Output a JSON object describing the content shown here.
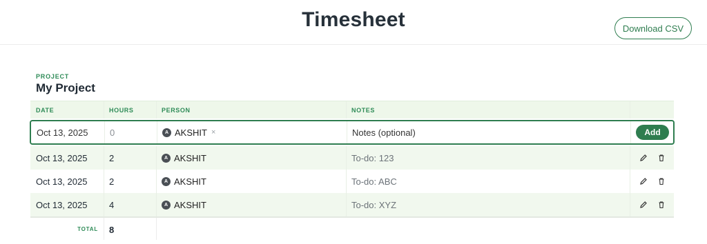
{
  "header": {
    "title": "Timesheet",
    "download_label": "Download CSV"
  },
  "project": {
    "label": "PROJECT",
    "name": "My Project"
  },
  "table": {
    "columns": [
      "DATE",
      "HOURS",
      "PERSON",
      "NOTES"
    ],
    "edit_row": {
      "date": "Oct 13, 2025",
      "hours": "0",
      "person_initial": "A",
      "person": "AKSHIT",
      "remove_glyph": "×",
      "notes_placeholder": "Notes (optional)",
      "add_label": "Add"
    },
    "rows": [
      {
        "date": "Oct 13, 2025",
        "hours": "2",
        "person_initial": "A",
        "person": "AKSHIT",
        "notes": "To-do: 123"
      },
      {
        "date": "Oct 13, 2025",
        "hours": "2",
        "person_initial": "A",
        "person": "AKSHIT",
        "notes": "To-do: ABC"
      },
      {
        "date": "Oct 13, 2025",
        "hours": "4",
        "person_initial": "A",
        "person": "AKSHIT",
        "notes": "To-do: XYZ"
      }
    ],
    "total_label": "TOTAL",
    "total_value": "8"
  },
  "icons": {
    "edit": "pencil-icon",
    "delete": "trash-icon"
  },
  "colors": {
    "accent": "#2e7d4f",
    "header_bg": "#eef7ea",
    "alt_row_bg": "#f1f8ee"
  }
}
